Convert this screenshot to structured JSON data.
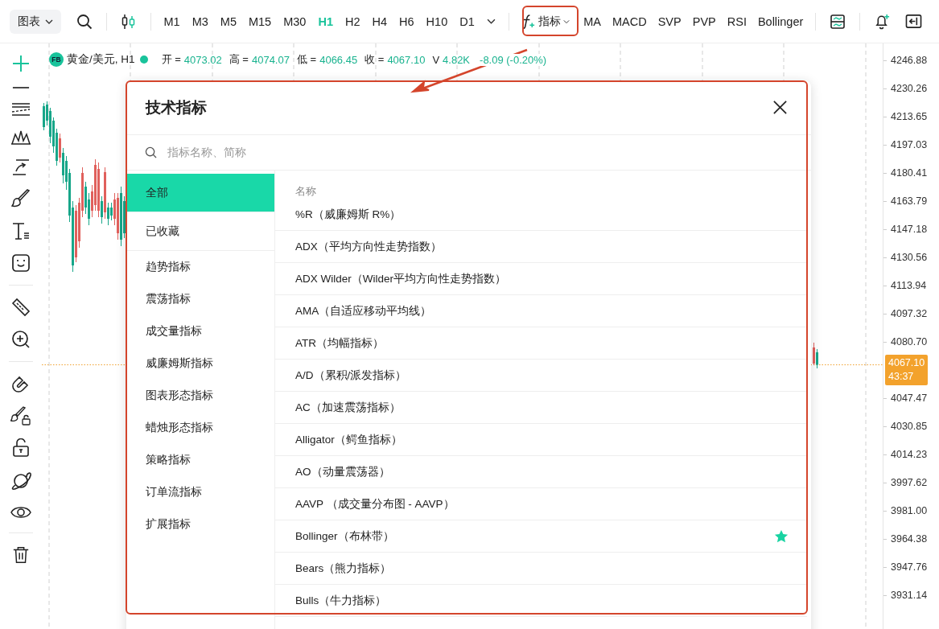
{
  "toolbar": {
    "chart_menu": "图表",
    "timeframes": [
      {
        "label": "M1",
        "selected": false
      },
      {
        "label": "M3",
        "selected": false
      },
      {
        "label": "M5",
        "selected": false
      },
      {
        "label": "M15",
        "selected": false
      },
      {
        "label": "M30",
        "selected": false
      },
      {
        "label": "H1",
        "selected": true
      },
      {
        "label": "H2",
        "selected": false
      },
      {
        "label": "H4",
        "selected": false
      },
      {
        "label": "H6",
        "selected": false
      },
      {
        "label": "H10",
        "selected": false
      },
      {
        "label": "D1",
        "selected": false
      }
    ],
    "indicator_button": "指标",
    "quick_indicators": [
      "MA",
      "MACD",
      "SVP",
      "PVP",
      "RSI",
      "Bollinger"
    ]
  },
  "legend": {
    "badge": "FB",
    "symbol": "黄金/美元, H1",
    "fields": [
      {
        "label": "开 =",
        "value": "4073.02"
      },
      {
        "label": "高 =",
        "value": "4074.07"
      },
      {
        "label": "低 =",
        "value": "4066.45"
      },
      {
        "label": "收 =",
        "value": "4067.10"
      },
      {
        "label": "V",
        "value": "4.82K"
      }
    ],
    "change": "-8.09 (-0.20%)"
  },
  "chart": {
    "chart_data": {
      "type": "candlestick",
      "ylim": [
        3911.12,
        4256.85
      ],
      "ref_lines": [
        {
          "axis": "y",
          "value": 4067.1
        }
      ],
      "categories": [
        null,
        null,
        null,
        null,
        null,
        null,
        null,
        null,
        null,
        null,
        null,
        null,
        null,
        null,
        null,
        null,
        null,
        null,
        null,
        null,
        null,
        null,
        null,
        null,
        null,
        null,
        null,
        null,
        null,
        null,
        null,
        null,
        null,
        null,
        null,
        null,
        null,
        null,
        null,
        null,
        null,
        null,
        null,
        null,
        null,
        null,
        null,
        null,
        null,
        null,
        null,
        null,
        null,
        null,
        null,
        null,
        null,
        null,
        null,
        null,
        null,
        null,
        null,
        null,
        null,
        null,
        null,
        null,
        null,
        null,
        null,
        null,
        null,
        null,
        null,
        null,
        null,
        null,
        null,
        null,
        null,
        null,
        null,
        null,
        null,
        null,
        null,
        null,
        null,
        null,
        null,
        null,
        null,
        null,
        null,
        null,
        null,
        null,
        null,
        null,
        null,
        null,
        null,
        null,
        null,
        null,
        null,
        null,
        null,
        null,
        null,
        null,
        null,
        null,
        null,
        null,
        null,
        null,
        null,
        null,
        null,
        null,
        null,
        null,
        null,
        null,
        null,
        null,
        null,
        null,
        null,
        null,
        null,
        null,
        null,
        null,
        null,
        null,
        null,
        null,
        null,
        null,
        null,
        null,
        null,
        null,
        null,
        null,
        null,
        null,
        null,
        null,
        null,
        null,
        null,
        null,
        null,
        null,
        null,
        null,
        null,
        null,
        null,
        null,
        null,
        null,
        null,
        null,
        null,
        null,
        null,
        null,
        null,
        null,
        null,
        null,
        null,
        null,
        null,
        null,
        null,
        null,
        null,
        null,
        null,
        null,
        null,
        null,
        null,
        null,
        null,
        null,
        null,
        null,
        null,
        null,
        null,
        null,
        null,
        null,
        null,
        null,
        null,
        null,
        null,
        null,
        null,
        null,
        null,
        null,
        null,
        null,
        null,
        null,
        null,
        null,
        null,
        null,
        null,
        null,
        null,
        null,
        null,
        null,
        null,
        null,
        null,
        null,
        null,
        null,
        null,
        null,
        null,
        null,
        null,
        null,
        null,
        null,
        null,
        null,
        null,
        null,
        null,
        null,
        null,
        null,
        null,
        null,
        null,
        null,
        null,
        null,
        null,
        null,
        null,
        null,
        null,
        null,
        null,
        null,
        null
      ],
      "yticks": [
        {
          "value": 4246.88,
          "label": "4246.88"
        },
        {
          "value": 4230.26,
          "label": "4230.26"
        },
        {
          "value": 4213.65,
          "label": "4213.65"
        },
        {
          "value": 4197.03,
          "label": "4197.03"
        },
        {
          "value": 4180.41,
          "label": "4180.41"
        },
        {
          "value": 4163.79,
          "label": "4163.79"
        },
        {
          "value": 4147.18,
          "label": "4147.18"
        },
        {
          "value": 4130.56,
          "label": "4130.56"
        },
        {
          "value": 4113.94,
          "label": "4113.94"
        },
        {
          "value": 4097.32,
          "label": "4097.32"
        },
        {
          "value": 4080.7,
          "label": "4080.70"
        },
        {
          "value": 4047.47,
          "label": "4047.47"
        },
        {
          "value": 4030.85,
          "label": "4030.85"
        },
        {
          "value": 4014.23,
          "label": "4014.23"
        },
        {
          "value": 3997.62,
          "label": "3997.62"
        },
        {
          "value": 3981.0,
          "label": "3981.00"
        },
        {
          "value": 3964.38,
          "label": "3964.38"
        },
        {
          "value": 3947.76,
          "label": "3947.76"
        },
        {
          "value": 3931.14,
          "label": "3931.14"
        }
      ],
      "ohlc": [
        [
          4219.81,
          4221.71,
          4205.56,
          4207.46
        ],
        [
          4220.76,
          4222.66,
          4208.41,
          4211.26
        ],
        [
          4216.96,
          4218.86,
          4197.97,
          4201.76
        ],
        [
          4211.26,
          4213.16,
          4192.27,
          4196.07
        ],
        [
          4204.14,
          4206.51,
          4184.67,
          4187.52
        ],
        [
          4189.42,
          4203.66,
          4186.57,
          4200.82
        ],
        [
          4192.27,
          4195.12,
          4174.22,
          4178.97
        ],
        [
          4187.52,
          4190.37,
          4170.42,
          4175.17
        ],
        [
          4180.39,
          4182.77,
          4151.42,
          4155.22
        ],
        [
          4159.97,
          4163.77,
          4121.98,
          4125.78
        ],
        [
          4130.53,
          4161.4,
          4127.68,
          4158.07
        ],
        [
          4140.03,
          4165.67,
          4136.23,
          4162.82
        ],
        [
          4158.07,
          4183.72,
          4154.27,
          4180.39
        ],
        [
          4172.32,
          4175.17,
          4156.17,
          4159.97
        ],
        [
          4164.72,
          4168.52,
          4149.52,
          4153.32
        ],
        [
          4158.07,
          4173.27,
          4154.27,
          4169.47
        ],
        [
          4161.4,
          4188.47,
          4158.07,
          4185.14
        ],
        [
          4158.07,
          4186.57,
          4154.27,
          4182.77
        ],
        [
          4163.77,
          4166.62,
          4150.47,
          4154.27
        ],
        [
          4157.12,
          4183.72,
          4153.32,
          4180.87
        ],
        [
          4159.97,
          4162.82,
          4149.52,
          4153.32
        ],
        [
          4159.97,
          4162.82,
          4152.37,
          4155.22
        ],
        [
          4153.32,
          4168.52,
          4149.52,
          4164.72
        ],
        [
          4144.77,
          4168.52,
          4140.98,
          4165.67
        ],
        [
          4168.52,
          4172.32,
          4137.18,
          4140.98
        ],
        [
          4163.77,
          4166.62,
          4141.93,
          4144.77
        ],
        null,
        null,
        null,
        null,
        null,
        null,
        null,
        null,
        null,
        null,
        null,
        null,
        null,
        null,
        null,
        null,
        null,
        null,
        null,
        null,
        null,
        null,
        null,
        null,
        null,
        null,
        null,
        null,
        null,
        null,
        null,
        null,
        null,
        null,
        null,
        null,
        null,
        null,
        null,
        null,
        null,
        null,
        null,
        null,
        null,
        null,
        null,
        null,
        null,
        null,
        null,
        null,
        null,
        null,
        null,
        null,
        null,
        null,
        null,
        null,
        null,
        null,
        null,
        null,
        null,
        null,
        null,
        null,
        null,
        null,
        null,
        null,
        null,
        null,
        null,
        null,
        null,
        null,
        null,
        null,
        null,
        null,
        null,
        null,
        null,
        null,
        null,
        null,
        null,
        null,
        null,
        null,
        null,
        null,
        null,
        null,
        null,
        null,
        null,
        null,
        null,
        null,
        null,
        null,
        null,
        null,
        null,
        null,
        null,
        null,
        null,
        null,
        null,
        null,
        null,
        null,
        null,
        null,
        null,
        null,
        null,
        null,
        null,
        null,
        null,
        null,
        null,
        null,
        null,
        null,
        null,
        null,
        null,
        null,
        null,
        null,
        null,
        null,
        null,
        null,
        null,
        null,
        null,
        null,
        null,
        null,
        null,
        null,
        null,
        null,
        null,
        null,
        null,
        null,
        null,
        null,
        null,
        null,
        null,
        null,
        null,
        null,
        null,
        null,
        null,
        null,
        null,
        null,
        null,
        null,
        null,
        null,
        null,
        null,
        null,
        null,
        null,
        null,
        null,
        null,
        null,
        null,
        null,
        null,
        null,
        null,
        null,
        null,
        null,
        null,
        null,
        null,
        null,
        null,
        null,
        null,
        null,
        null,
        null,
        null,
        null,
        null,
        null,
        null,
        null,
        null,
        null,
        null,
        null,
        null,
        null,
        null,
        null,
        [
          4067.84,
          4080.19,
          4066.89,
          4077.34
        ],
        [
          4074.49,
          4076.39,
          4065.0,
          4067.1
        ],
        null,
        null,
        null,
        null,
        null,
        null,
        null,
        null,
        null,
        null,
        null,
        null,
        null,
        null,
        null,
        null,
        null,
        null,
        null,
        null
      ]
    }
  },
  "price_axis": {
    "current_price": "4067.10",
    "countdown": "43:37"
  },
  "dialog": {
    "title": "技术指标",
    "search": {
      "placeholder": "指标名称、简称"
    },
    "categories": [
      {
        "label": "全部",
        "selected": true
      },
      {
        "label": "已收藏",
        "selected": false
      },
      {
        "label": "趋势指标",
        "selected": false
      },
      {
        "label": "震荡指标",
        "selected": false
      },
      {
        "label": "成交量指标",
        "selected": false
      },
      {
        "label": "威廉姆斯指标",
        "selected": false
      },
      {
        "label": "图表形态指标",
        "selected": false
      },
      {
        "label": "蜡烛形态指标",
        "selected": false
      },
      {
        "label": "策略指标",
        "selected": false
      },
      {
        "label": "订单流指标",
        "selected": false
      },
      {
        "label": "扩展指标",
        "selected": false
      }
    ],
    "column_header": "名称",
    "indicators": [
      {
        "name": "%R（威廉姆斯 R%）",
        "favorite": false
      },
      {
        "name": "ADX（平均方向性走势指数）",
        "favorite": false
      },
      {
        "name": "ADX Wilder（Wilder平均方向性走势指数）",
        "favorite": false
      },
      {
        "name": "AMA（自适应移动平均线）",
        "favorite": false
      },
      {
        "name": "ATR（均幅指标）",
        "favorite": false
      },
      {
        "name": "A/D（累积/派发指标）",
        "favorite": false
      },
      {
        "name": "AC（加速震荡指标）",
        "favorite": false
      },
      {
        "name": "Alligator（鳄鱼指标）",
        "favorite": false
      },
      {
        "name": "AO（动量震荡器）",
        "favorite": false
      },
      {
        "name": "AAVP （成交量分布图 - AAVP）",
        "favorite": false
      },
      {
        "name": "Bollinger（布林带）",
        "favorite": true
      },
      {
        "name": "Bears（熊力指标）",
        "favorite": false
      },
      {
        "name": "Bulls（牛力指标）",
        "favorite": false
      }
    ]
  }
}
